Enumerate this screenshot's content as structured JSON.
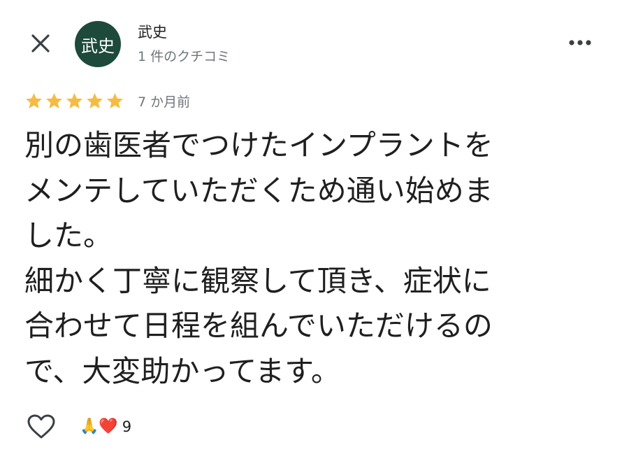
{
  "header": {
    "close_icon": "close-icon",
    "more_icon": "more-horiz-icon"
  },
  "author": {
    "avatar_text": "武史",
    "avatar_color": "#1d4a3a",
    "name": "武史",
    "meta": "1 件のクチコミ"
  },
  "rating": {
    "stars": 5,
    "max_stars": 5,
    "star_color": "#f6bb42",
    "time": "7 か月前"
  },
  "review": {
    "text": "別の歯医者でつけたインプラントを\nメンテしていただくため通い始めま\nした。\n細かく丁寧に観察して頂き、症状に\n合わせて日程を組んでいただけるの\nで、大変助かってます。"
  },
  "footer": {
    "like_icon": "heart-outline-icon",
    "reactions_emoji": "🙏❤️",
    "reactions_count": "9"
  }
}
